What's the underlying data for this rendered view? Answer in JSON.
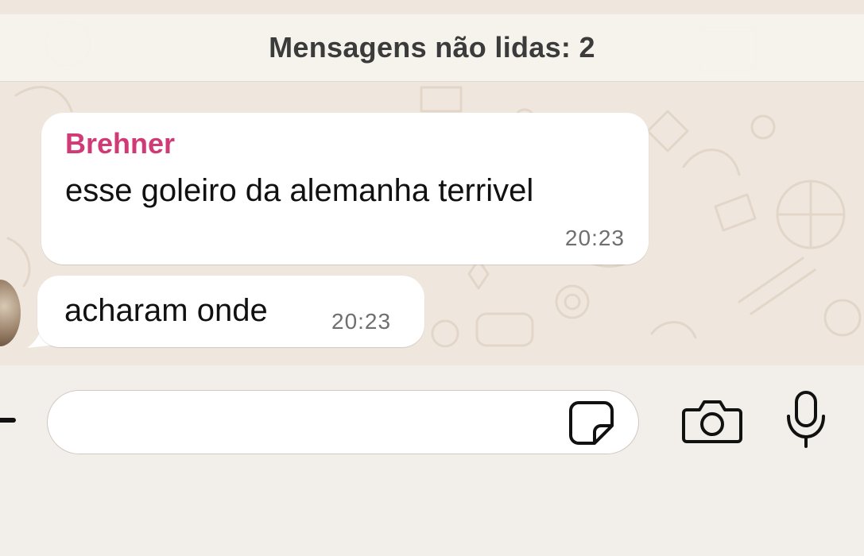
{
  "unread_banner": {
    "text": "Mensagens não lidas: 2"
  },
  "messages": [
    {
      "sender": "Brehner",
      "text": "esse goleiro da alemanha terrivel",
      "time": "20:23"
    },
    {
      "text": "acharam onde",
      "time": "20:23"
    }
  ],
  "composer": {
    "value": "",
    "placeholder": ""
  },
  "icons": {
    "attach": "plus-icon",
    "sticker": "sticker-icon",
    "camera": "camera-icon",
    "microphone": "mic-icon"
  },
  "colors": {
    "sender_name": "#d03a76",
    "chat_background": "#efe7dd",
    "bubble": "#ffffff"
  }
}
